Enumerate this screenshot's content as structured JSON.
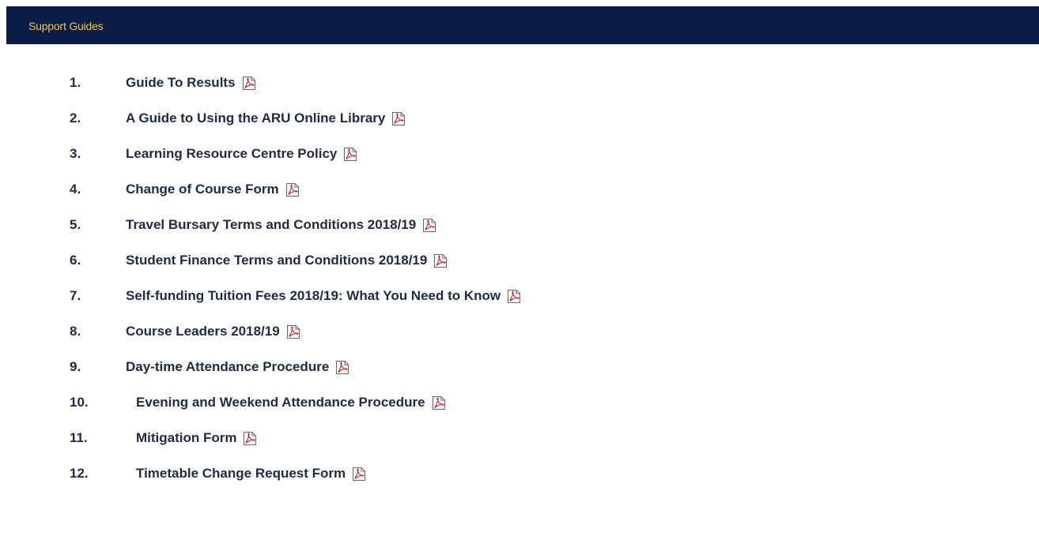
{
  "header": {
    "title": "Support Guides",
    "background": "#0b1d44",
    "title_color": "#f2c34a"
  },
  "guides": [
    {
      "number": "1.",
      "label": "Guide To Results",
      "icon": "pdf-icon"
    },
    {
      "number": "2.",
      "label": "A Guide to Using the ARU Online Library",
      "icon": "pdf-icon"
    },
    {
      "number": "3.",
      "label": "Learning Resource Centre Policy",
      "icon": "pdf-icon"
    },
    {
      "number": "4.",
      "label": "Change of Course Form",
      "icon": "pdf-icon"
    },
    {
      "number": "5.",
      "label": "Travel Bursary Terms and Conditions 2018/19",
      "icon": "pdf-icon"
    },
    {
      "number": "6.",
      "label": "Student Finance Terms and Conditions 2018/19",
      "icon": "pdf-icon"
    },
    {
      "number": "7.",
      "label": "Self-funding Tuition Fees 2018/19: What You Need to Know",
      "icon": "pdf-icon"
    },
    {
      "number": "8.",
      "label": "Course Leaders 2018/19",
      "icon": "pdf-icon"
    },
    {
      "number": "9.",
      "label": "Day-time Attendance Procedure",
      "icon": "pdf-icon"
    },
    {
      "number": "10.",
      "label": "Evening and Weekend Attendance Procedure",
      "icon": "pdf-icon"
    },
    {
      "number": "11.",
      "label": "Mitigation Form",
      "icon": "pdf-icon"
    },
    {
      "number": "12.",
      "label": "Timetable Change Request Form",
      "icon": "pdf-icon"
    }
  ],
  "colors": {
    "text": "#1f2a44",
    "pdf_icon": "#c8202a"
  }
}
